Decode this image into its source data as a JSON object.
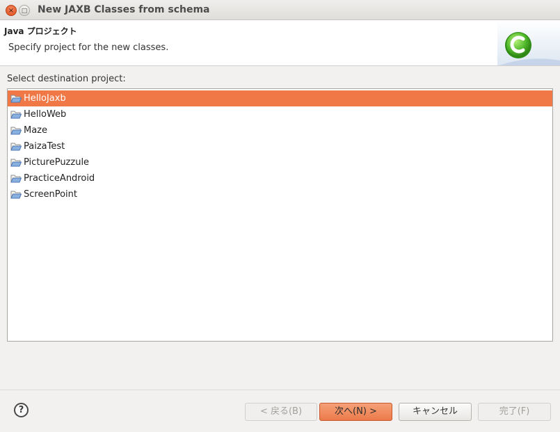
{
  "window": {
    "title": "New JAXB Classes from schema",
    "close_glyph": "×",
    "maximize_glyph": "□"
  },
  "header": {
    "title": "Java プロジェクト",
    "description": "Specify project for the new classes.",
    "banner_icon": "java-class-c-icon"
  },
  "list": {
    "label": "Select destination project:",
    "items": [
      {
        "label": "HelloJaxb",
        "selected": true
      },
      {
        "label": "HelloWeb"
      },
      {
        "label": "Maze"
      },
      {
        "label": "PaizaTest"
      },
      {
        "label": "PicturePuzzule"
      },
      {
        "label": "PracticeAndroid"
      },
      {
        "label": "ScreenPoint"
      }
    ]
  },
  "footer": {
    "help": "?",
    "back": "< 戻る(B)",
    "next": "次へ(N) >",
    "cancel": "キャンセル",
    "finish": "完了(F)"
  },
  "colors": {
    "selection": "#f07746",
    "accent": "#df4b16",
    "banner_green": "#3aa51f"
  }
}
